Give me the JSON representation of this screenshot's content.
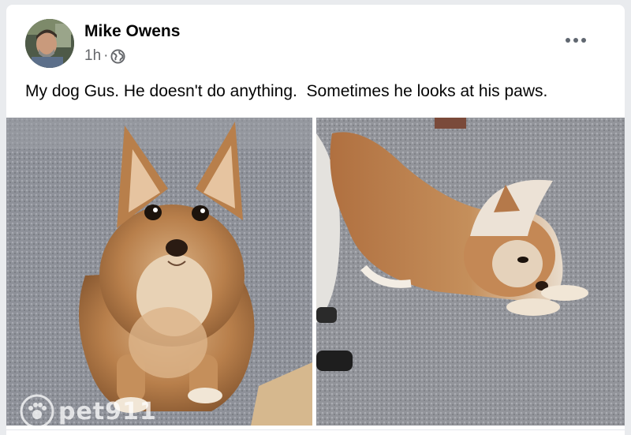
{
  "post": {
    "author": "Mike Owens",
    "timestamp": "1h",
    "separator": "·",
    "audience_icon": "globe-icon",
    "text": "My dog Gus. He doesn't do anything.  Sometimes he looks at his paws.",
    "more_icon": "more-options-icon"
  },
  "photos": [
    {
      "subject": "dog-looking-at-camera"
    },
    {
      "subject": "dog-looking-at-paws"
    }
  ],
  "watermark": {
    "text": "pet911"
  },
  "colors": {
    "background": "#e9ebee",
    "card": "#ffffff",
    "text_primary": "#050505",
    "text_secondary": "#65676b",
    "carpet": "#8a8d95",
    "dog_fur": "#b87f4b"
  }
}
